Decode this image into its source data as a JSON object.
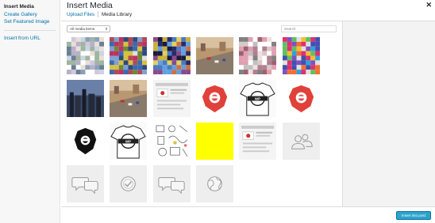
{
  "menu": {
    "items": [
      {
        "label": "Insert Media",
        "active": true
      },
      {
        "label": "Create Gallery",
        "active": false
      },
      {
        "label": "Set Featured Image",
        "active": false
      }
    ],
    "url_item": {
      "label": "Insert from URL"
    }
  },
  "frame": {
    "title": "Insert Media",
    "close_icon": "close-icon",
    "tabs": [
      {
        "label": "Upload Files",
        "active": false
      },
      {
        "label": "Media Library",
        "active": true
      }
    ]
  },
  "library": {
    "filter": {
      "selected": "All media items"
    },
    "search": {
      "placeholder": "Search"
    },
    "items": [
      {
        "kind": "pixel-mosaic"
      },
      {
        "kind": "pixel-mosaic"
      },
      {
        "kind": "pixel-mosaic"
      },
      {
        "kind": "photo-city"
      },
      {
        "kind": "pixel-mosaic"
      },
      {
        "kind": "pixel-mosaic"
      },
      {
        "kind": "photo-skyline"
      },
      {
        "kind": "photo-city"
      },
      {
        "kind": "screenshot"
      },
      {
        "kind": "red-badge"
      },
      {
        "kind": "tshirt"
      },
      {
        "kind": "red-badge"
      },
      {
        "kind": "black-badge"
      },
      {
        "kind": "tshirt"
      },
      {
        "kind": "sketches"
      },
      {
        "kind": "yellow-square"
      },
      {
        "kind": "screenshot"
      },
      {
        "kind": "people-icon"
      },
      {
        "kind": "speech-bubbles-icon"
      },
      {
        "kind": "checkmark-icon"
      },
      {
        "kind": "speech-bubbles-icon"
      },
      {
        "kind": "globe-icon"
      }
    ]
  },
  "toolbar": {
    "insert_label": "Insert into post"
  },
  "colors": {
    "accent": "#2ea2cc",
    "link": "#0073aa"
  }
}
